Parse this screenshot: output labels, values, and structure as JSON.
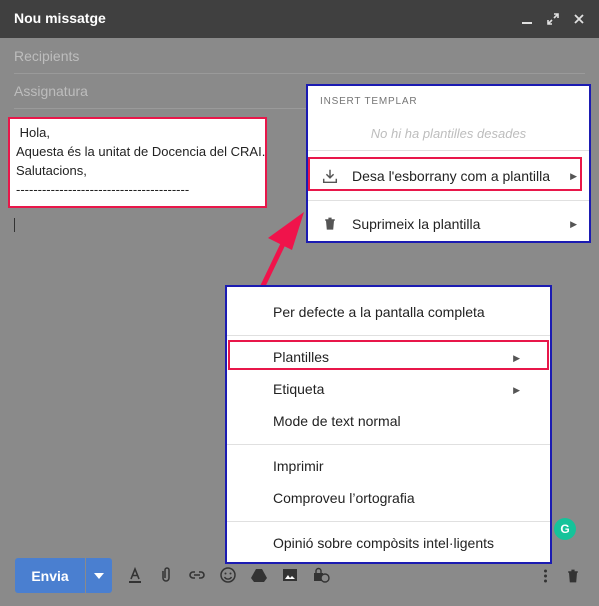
{
  "window": {
    "title": "Nou missatge"
  },
  "fields": {
    "recipients": "Recipients",
    "signature": "Assignatura"
  },
  "message": {
    "lines": [
      " Hola,",
      "Aquesta és la unitat de Docencia del CRAI.",
      "Salutacions,",
      "----------------------------------------"
    ]
  },
  "templates_panel": {
    "header": "INSERT TEMPLAR",
    "empty_text": "No hi ha plantilles desades",
    "save_label": "Desa l'esborrany com a plantilla",
    "delete_label": "Suprimeix la plantilla"
  },
  "menu": {
    "fullscreen": "Per defecte a la pantalla completa",
    "templates": "Plantilles",
    "label": "Etiqueta",
    "plain_text": "Mode de text normal",
    "print": "Imprimir",
    "spellcheck": "Comproveu l’ortografia",
    "smart_compose_feedback": "Opinió sobre compòsits intel·ligents"
  },
  "toolbar": {
    "send_label": "Envia"
  },
  "colors": {
    "highlight_red": "#e8174a",
    "highlight_blue": "#1b1bb2",
    "send_blue": "#4a7fd0",
    "titlebar": "#404040"
  }
}
